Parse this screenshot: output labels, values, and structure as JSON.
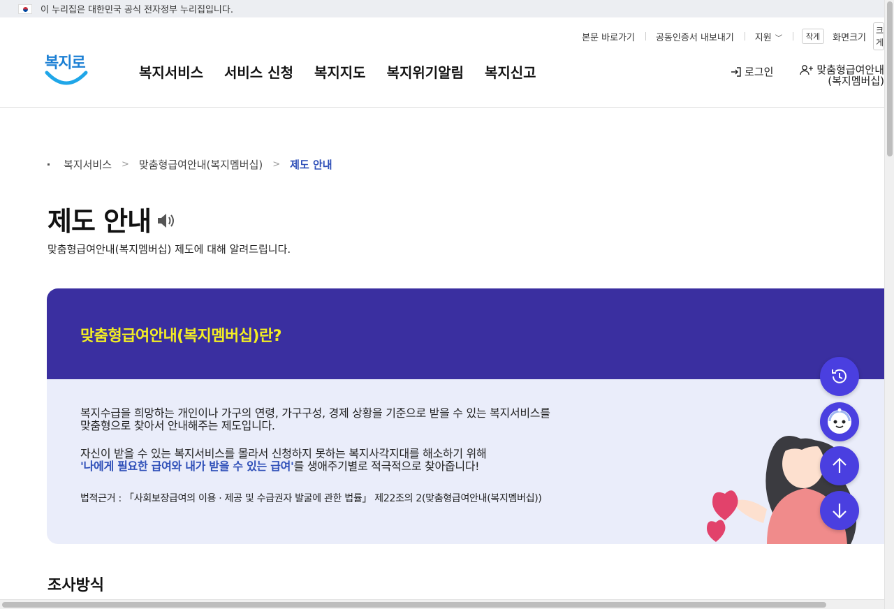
{
  "gov_bar": {
    "notice": "이 누리집은 대한민국 공식 전자정부 누리집입니다."
  },
  "utility": {
    "skip_link": "본문 바로가기",
    "cert_export": "공동인증서 내보내기",
    "support": "지원",
    "small_text": "작게",
    "screen_size": "화면크기",
    "large_text": "크게"
  },
  "logo": {
    "text": "복지로"
  },
  "gnb": {
    "items": [
      "복지서비스",
      "서비스 신청",
      "복지지도",
      "복지위기알림",
      "복지신고"
    ]
  },
  "member": {
    "login": "로그인",
    "join_line1": "맞춤형급여안내",
    "join_line2": "(복지멤버십)"
  },
  "breadcrumb": {
    "items": [
      "복지서비스",
      "맞춤형급여안내(복지멤버십)",
      "제도 안내"
    ]
  },
  "page": {
    "title": "제도 안내",
    "description": "맞춤형급여안내(복지멤버십) 제도에 대해 알려드립니다."
  },
  "card": {
    "heading": "맞춤형급여안내(복지멤버십)란?",
    "para1_line1": "복지수급을 희망하는 개인이나 가구의 연령, 가구구성, 경제 상황을 기준으로 받을 수 있는 복지서비스를",
    "para1_line2": "맞춤형으로 찾아서 안내해주는 제도입니다.",
    "para2_line1": "자신이 받을 수 있는 복지서비스를 몰라서 신청하지 못하는 복지사각지대를 해소하기 위해",
    "para2_highlight": "'나에게 필요한 급여와 내가 받을 수 있는 급여'",
    "para2_rest": "를 생애주기별로 적극적으로 찾아줍니다!",
    "law": "법적근거 : 「사회보장급여의 이용 · 제공 및 수급권자 발굴에 관한 법률」 제22조의 2(맞춤형급여안내(복지멤버십))"
  },
  "section": {
    "title": "조사방식"
  },
  "colors": {
    "header_bg": "#3a2fa0",
    "heading_yellow": "#f3ee23",
    "accent_blue": "#2e4fb8",
    "fab": "#4a3fe0"
  }
}
